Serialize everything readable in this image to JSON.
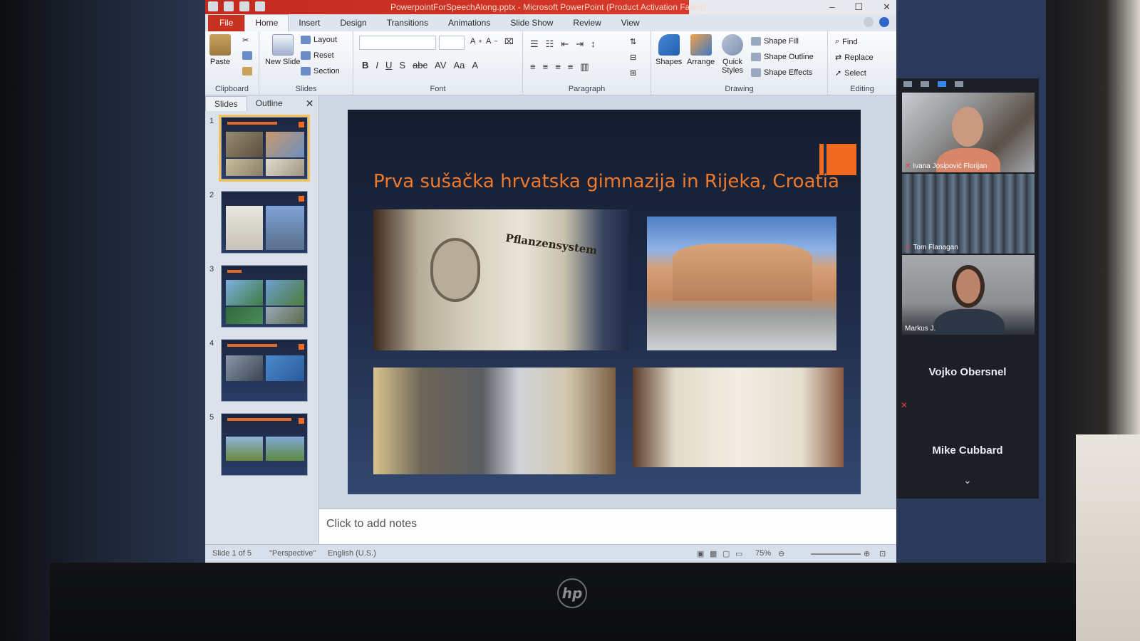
{
  "app": {
    "title": "PowerpointForSpeechAlong.pptx - Microsoft PowerPoint (Product Activation Failed)"
  },
  "ribbon": {
    "tabs": [
      "File",
      "Home",
      "Insert",
      "Design",
      "Transitions",
      "Animations",
      "Slide Show",
      "Review",
      "View"
    ],
    "active_tab": "Home",
    "groups": {
      "clipboard": {
        "label": "Clipboard",
        "paste": "Paste"
      },
      "slides": {
        "label": "Slides",
        "new_slide": "New Slide",
        "layout": "Layout",
        "reset": "Reset",
        "section": "Section"
      },
      "font": {
        "label": "Font"
      },
      "paragraph": {
        "label": "Paragraph"
      },
      "drawing": {
        "label": "Drawing",
        "shapes": "Shapes",
        "arrange": "Arrange",
        "quick_styles": "Quick Styles",
        "shape_fill": "Shape Fill",
        "shape_outline": "Shape Outline",
        "shape_effects": "Shape Effects"
      },
      "editing": {
        "label": "Editing",
        "find": "Find",
        "replace": "Replace",
        "select": "Select"
      }
    }
  },
  "panel": {
    "tabs": [
      "Slides",
      "Outline"
    ],
    "active_tab": "Slides",
    "thumbnails": [
      "1",
      "2",
      "3",
      "4",
      "5"
    ],
    "selected": 1
  },
  "slide": {
    "title": "Prva sušačka hrvatska gimnazija in Rijeka, Croatia",
    "book_text": "Pflanzensystem"
  },
  "notes": {
    "placeholder": "Click to add notes"
  },
  "status": {
    "slide_count": "Slide 1 of 5",
    "theme": "\"Perspective\"",
    "language": "English (U.S.)",
    "zoom": "75%"
  },
  "video_call": {
    "participants": [
      {
        "name": "Ivana Josipović Florijan",
        "video": true
      },
      {
        "name": "Tom Flanagan",
        "video": true
      },
      {
        "name": "Markus J.",
        "video": true
      },
      {
        "name": "Vojko Obersnel",
        "video": false
      },
      {
        "name": "Mike Cubbard",
        "video": false
      }
    ]
  },
  "device": {
    "brand": "hp"
  },
  "colors": {
    "accent": "#f06a1f",
    "file_tab": "#c6321f",
    "slide_bg": "#1e2a46"
  }
}
